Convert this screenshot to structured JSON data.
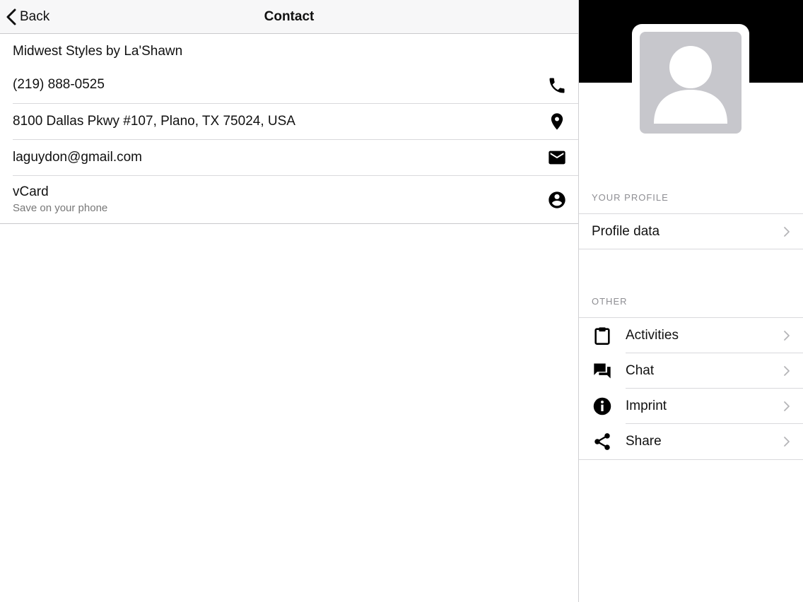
{
  "navbar": {
    "back_label": "Back",
    "title": "Contact"
  },
  "contact": {
    "business_name": "Midwest Styles by La'Shawn",
    "phone": "(219) 888-0525",
    "address": "8100 Dallas Pkwy #107, Plano, TX 75024, USA",
    "email": "laguydon@gmail.com",
    "vcard_label": "vCard",
    "vcard_sub": "Save on your phone"
  },
  "sidebar": {
    "profile_header": "YOUR PROFILE",
    "profile_item": "Profile data",
    "other_header": "OTHER",
    "items": [
      {
        "label": "Activities",
        "icon": "clipboard-icon"
      },
      {
        "label": "Chat",
        "icon": "chat-icon"
      },
      {
        "label": "Imprint",
        "icon": "info-icon"
      },
      {
        "label": "Share",
        "icon": "share-icon"
      }
    ]
  }
}
